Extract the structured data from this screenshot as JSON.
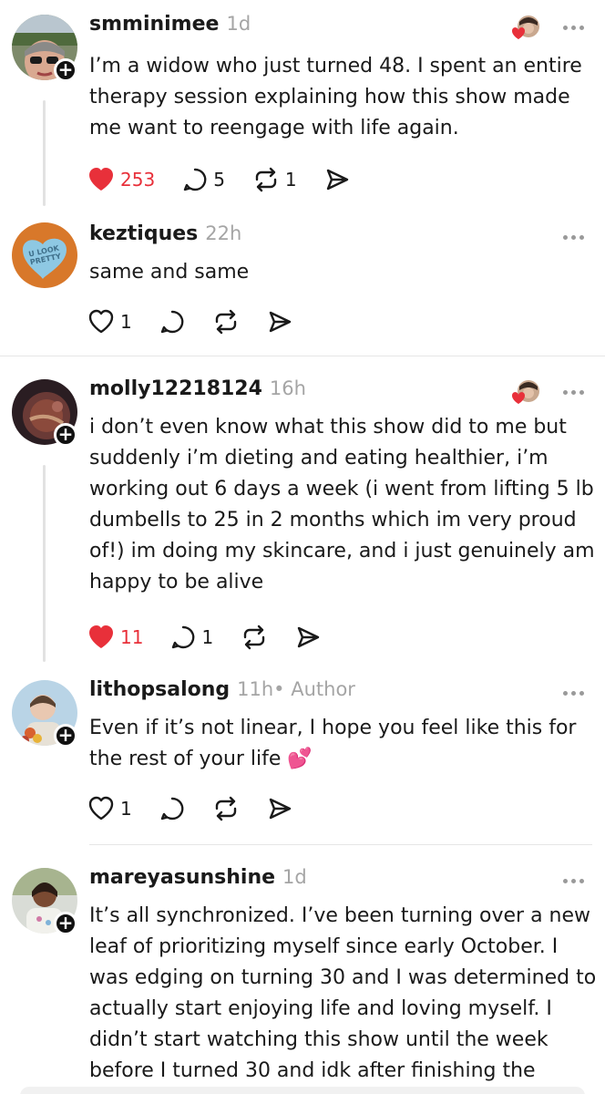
{
  "posts": [
    {
      "username": "smminimee",
      "time": "1d",
      "text": "I’m a widow who just turned 48. I spent an entire therapy session explaining how this show made me want to reengage with life again.",
      "likes": "253",
      "comments": "5",
      "reposts": "1"
    },
    {
      "username": "keztiques",
      "time": "22h",
      "text": "same and same",
      "likes": "1",
      "avatar_text": "U LOOK PRETTY"
    },
    {
      "username": "molly12218124",
      "time": "16h",
      "text": "i don’t even know what this show did to me but suddenly i’m dieting and eating healthier, i’m working out 6 days a week (i went from lifting 5 lb dumbells to 25 in 2 months which im very proud of!) im doing my skincare, and i just genuinely am happy to be alive",
      "likes": "11",
      "comments": "1"
    },
    {
      "username": "lithopsalong",
      "time": "11h",
      "author_label": " • Author",
      "text": "Even if it’s not linear, I hope you feel like this for the rest of your life 💕",
      "likes": "1"
    },
    {
      "username": "mareyasunshine",
      "time": "1d",
      "text": "It’s all synchronized. I’ve been turning over a new leaf of prioritizing myself since early October. I was edging on turning 30 and I was determined to actually start enjoying life and loving myself.  I didn’t start watching this show until the week before I turned 30 and idk after finishing the"
    }
  ],
  "colors": {
    "like_red": "#e8303a",
    "muted": "#a5a5a5",
    "text": "#1a1a1a"
  },
  "icons": [
    "heart-icon",
    "comment-icon",
    "repost-icon",
    "share-icon",
    "more-icon",
    "plus-icon"
  ]
}
